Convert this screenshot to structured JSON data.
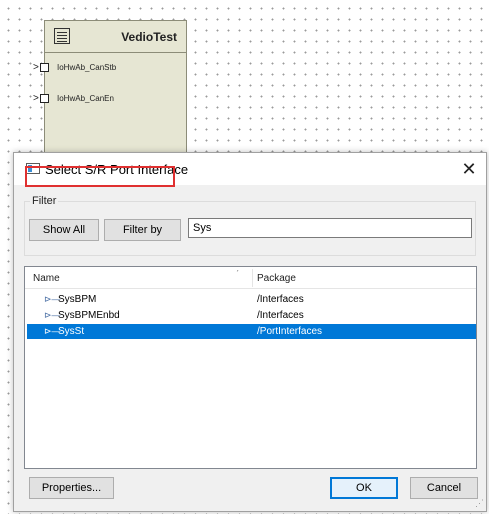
{
  "canvas": {
    "component": {
      "title": "VedioTest",
      "ports": [
        "IoHwAb_CanStb",
        "IoHwAb_CanEn"
      ]
    }
  },
  "dialog": {
    "title": "Select S/R Port Interface",
    "close_glyph": "✕",
    "filter": {
      "group_label": "Filter",
      "show_all_label": "Show All",
      "filter_by_label": "Filter by",
      "input_value": "Sys"
    },
    "list": {
      "columns": [
        "Name",
        "Package"
      ],
      "rows": [
        {
          "name": "SysBPM",
          "package": "/Interfaces",
          "selected": false
        },
        {
          "name": "SysBPMEnbd",
          "package": "/Interfaces",
          "selected": false
        },
        {
          "name": "SysSt",
          "package": "/PortInterfaces",
          "selected": true
        }
      ]
    },
    "buttons": {
      "properties": "Properties...",
      "ok": "OK",
      "cancel": "Cancel"
    }
  },
  "colors": {
    "selection": "#0078d7",
    "highlight_box": "#e03030",
    "component_fill": "#e6e6d3"
  }
}
